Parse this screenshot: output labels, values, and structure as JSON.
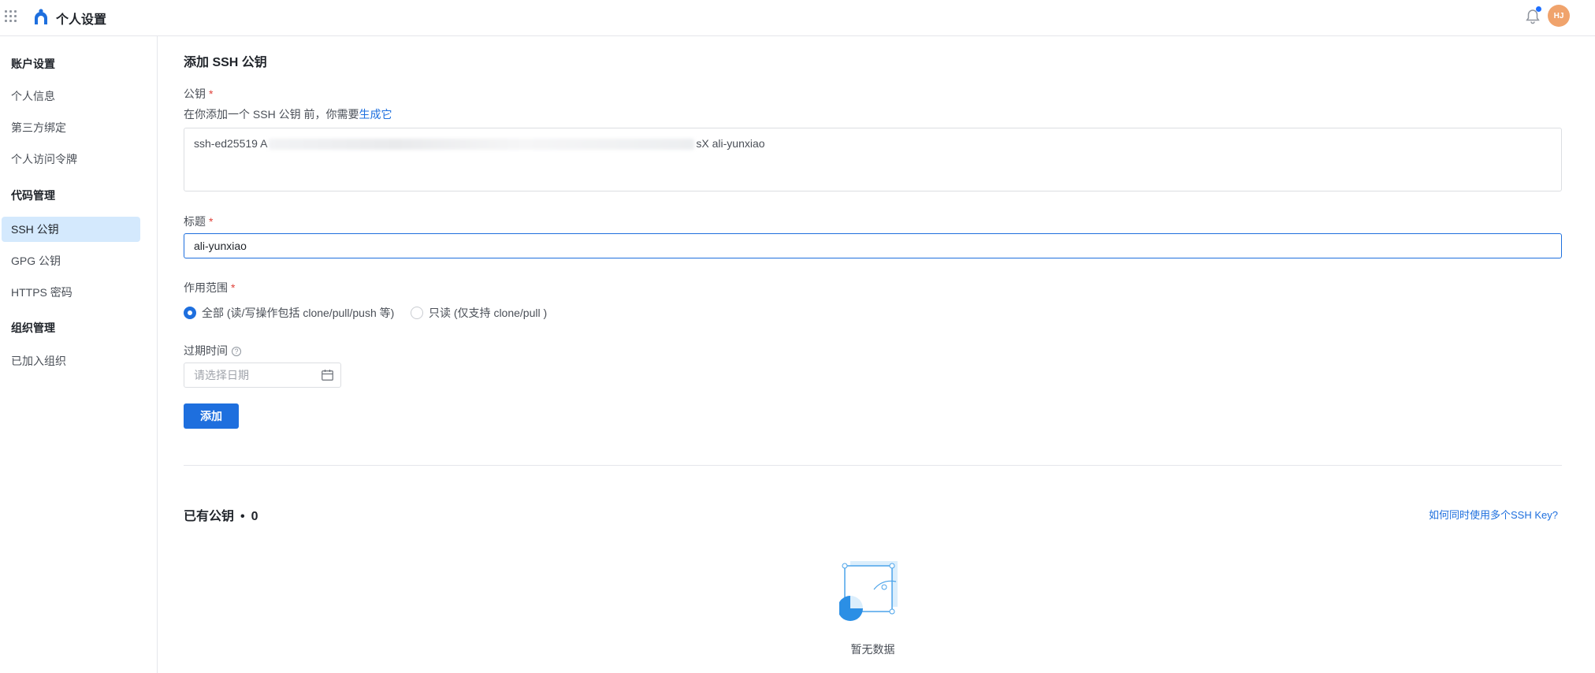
{
  "header": {
    "title": "个人设置",
    "avatar_initials": "HJ",
    "accent_color": "#1e6fde",
    "avatar_color": "#f0a36c"
  },
  "sidebar": {
    "groups": [
      {
        "label": "账户设置",
        "items": [
          "个人信息",
          "第三方绑定",
          "个人访问令牌"
        ]
      },
      {
        "label": "代码管理",
        "items": [
          "SSH 公钥",
          "GPG 公钥",
          "HTTPS 密码"
        ]
      },
      {
        "label": "组织管理",
        "items": [
          "已加入组织"
        ]
      }
    ],
    "active_item": "SSH 公钥"
  },
  "form": {
    "section_title": "添加 SSH 公钥",
    "public_key_label": "公钥",
    "required_mark": "*",
    "hint_prefix": "在你添加一个 SSH 公钥 前，你需要",
    "hint_link": "生成它",
    "public_key_value_start": "ssh-ed25519 A",
    "public_key_value_end": "sX ali-yunxiao",
    "title_label": "标题",
    "title_value": "ali-yunxiao",
    "scope_label": "作用范围",
    "scope_options": [
      {
        "label": "全部 (读/写操作包括 clone/pull/push 等)",
        "checked": true
      },
      {
        "label": "只读 (仅支持 clone/pull )",
        "checked": false
      }
    ],
    "expire_label": "过期时间",
    "expire_placeholder": "请选择日期",
    "submit_label": "添加"
  },
  "list": {
    "title": "已有公钥",
    "separator": "•",
    "count": "0",
    "help_link": "如何同时使用多个SSH Key?",
    "empty_text": "暂无数据"
  }
}
